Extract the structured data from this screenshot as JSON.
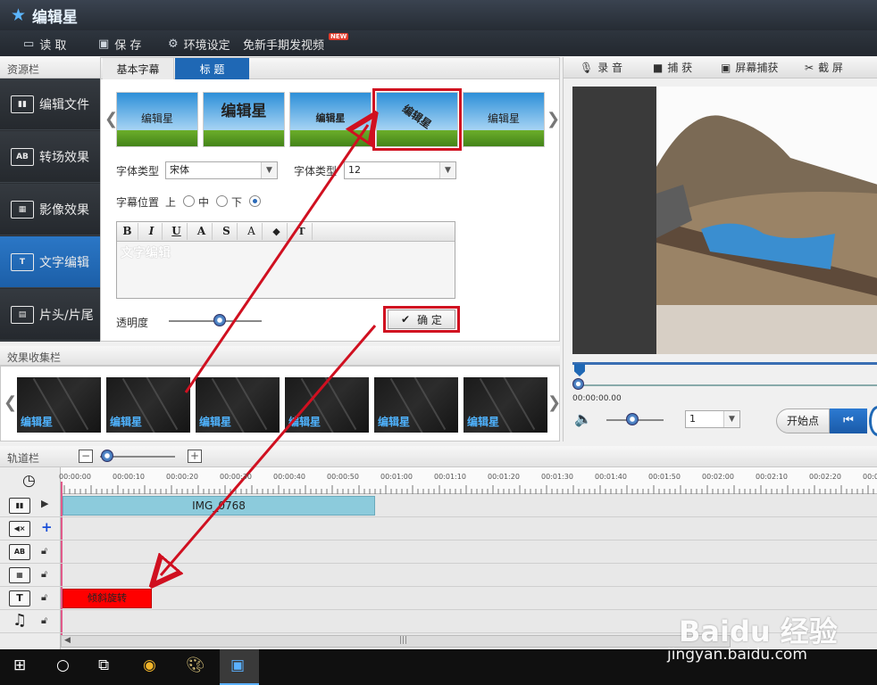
{
  "app": {
    "title": "编辑星"
  },
  "menu": {
    "open": "读 取",
    "save": "保 存",
    "env": "环境设定",
    "promo": "免新手期发视频",
    "promo_badge": "NEW"
  },
  "left": {
    "header": "资源栏",
    "nav": [
      {
        "label": "编辑文件",
        "icon": "film-icon"
      },
      {
        "label": "转场效果",
        "icon": "ab-transition-icon"
      },
      {
        "label": "影像效果",
        "icon": "video-effect-icon"
      },
      {
        "label": "文字编辑",
        "icon": "text-icon",
        "active": true
      },
      {
        "label": "片头/片尾",
        "icon": "intro-outro-icon"
      }
    ]
  },
  "panel": {
    "tabs": [
      "基本字幕",
      "标 题"
    ],
    "active_tab": 1,
    "thumbs": [
      "编辑星",
      "编辑星",
      "编辑星",
      "编辑星",
      "编辑星"
    ],
    "selected_thumb": 3,
    "font_type_label": "字体类型",
    "font_type_value": "宋体",
    "font_size_label": "字体类型",
    "font_size_value": "12",
    "position_label": "字幕位置",
    "pos_top": "上",
    "pos_mid": "中",
    "pos_bottom": "下",
    "pos_selected": "下",
    "format_buttons": [
      "B",
      "I",
      "U",
      "A",
      "S",
      "A",
      "◆",
      "T"
    ],
    "editor_text": "文字编辑",
    "opacity_label": "透明度",
    "opacity_value": 0.55,
    "ok_label": "确 定"
  },
  "right": {
    "tools": [
      "录 音",
      "捕 获",
      "屏幕捕获",
      "截 屏"
    ],
    "time": "00:00:00.00",
    "volume": 0.45,
    "speed_value": "1",
    "start_point": "开始点",
    "progress": 0
  },
  "effects": {
    "header": "效果收集栏",
    "items": [
      "编辑星",
      "编辑星",
      "编辑星",
      "编辑星",
      "编辑星",
      "编辑星"
    ]
  },
  "track": {
    "header": "轨道栏",
    "zoom": 0.1,
    "ruler": [
      "00:00:00",
      "00:00:10",
      "00:00:20",
      "00:00:30",
      "00:00:40",
      "00:00:50",
      "00:01:00",
      "00:01:10",
      "00:01:20",
      "00:01:30",
      "00:01:40",
      "00:01:50",
      "00:02:00",
      "00:02:10",
      "00:02:20",
      "00:02:3"
    ],
    "video_clip": "IMG_0768",
    "text_clip": "倾斜旋转"
  },
  "watermark": {
    "logo": "Baidu 经验",
    "url": "jingyan.baidu.com"
  },
  "colors": {
    "accent": "#1f68b5",
    "highlight": "#d01020",
    "clip_video": "#8ccbdc",
    "clip_text": "#ff0000"
  }
}
